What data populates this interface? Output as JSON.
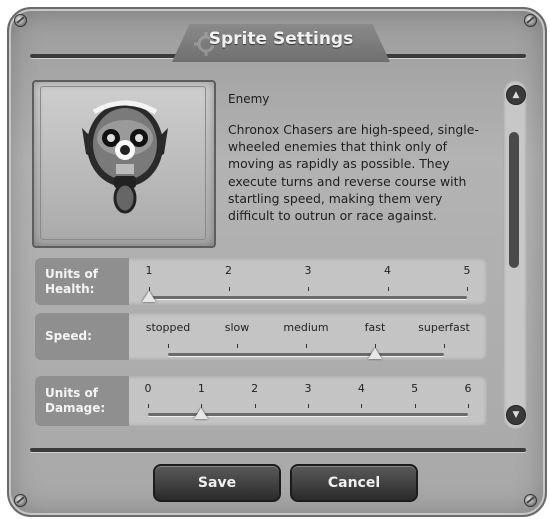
{
  "title": "Sprite Settings",
  "sprite": {
    "name": "Enemy",
    "description": "Chronox Chasers are high-speed, single-wheeled enemies that think only of moving as rapidly as possible. They execute turns and reverse course with startling speed, making them very difficult to outrun or race against.",
    "portrait_icon": "chronox-chaser-robot-icon"
  },
  "settings": [
    {
      "label_line1": "Units of",
      "label_line2": "Health:",
      "ticks": [
        "1",
        "2",
        "3",
        "4",
        "5"
      ],
      "value": "1",
      "value_fraction": 0.0
    },
    {
      "label_line1": "Speed:",
      "label_line2": "",
      "ticks": [
        "stopped",
        "slow",
        "medium",
        "fast",
        "superfast"
      ],
      "value": "fast",
      "value_fraction": 0.75
    },
    {
      "label_line1": "Units of",
      "label_line2": "Damage:",
      "ticks": [
        "0",
        "1",
        "2",
        "3",
        "4",
        "5",
        "6"
      ],
      "value": "1",
      "value_fraction": 0.1667
    }
  ],
  "scrollbar": {
    "up_icon": "scroll-up-icon",
    "down_icon": "scroll-down-icon",
    "position_fraction": 0.0
  },
  "buttons": {
    "save": "Save",
    "cancel": "Cancel"
  }
}
